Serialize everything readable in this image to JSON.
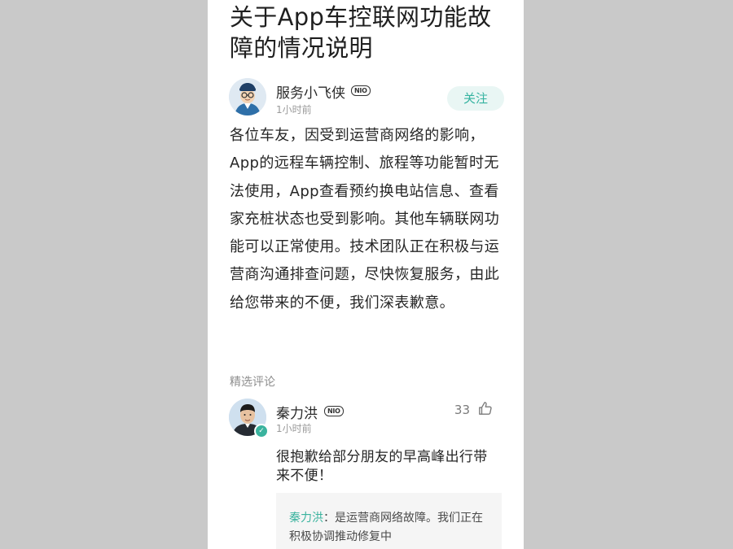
{
  "article": {
    "title": "关于App车控联网功能故障的情况说明",
    "author": {
      "name": "服务小飞侠",
      "badge": "NIO",
      "time": "1小时前"
    },
    "follow_label": "关注",
    "body": "各位车友，因受到运营商网络的影响，App的远程车辆控制、旅程等功能暂时无法使用，App查看预约换电站信息、查看家充桩状态也受到影响。其他车辆联网功能可以正常使用。技术团队正在积极与运营商沟通排查问题，尽快恢复服务，由此给您带来的不便，我们深表歉意。"
  },
  "comments_section": {
    "label": "精选评论",
    "comments": [
      {
        "name": "秦力洪",
        "badge": "NIO",
        "time": "1小时前",
        "likes": "33",
        "text": "很抱歉给部分朋友的早高峰出行带来不便！",
        "reply": {
          "author": "秦力洪",
          "text": "：是运营商网络故障。我们正在积极协调推动修复中"
        }
      }
    ]
  },
  "icons": {
    "like": "thumbs-up-icon",
    "verified": "verified-check-icon"
  },
  "colors": {
    "accent": "#35b3a0",
    "background": "#c9c9c9"
  }
}
